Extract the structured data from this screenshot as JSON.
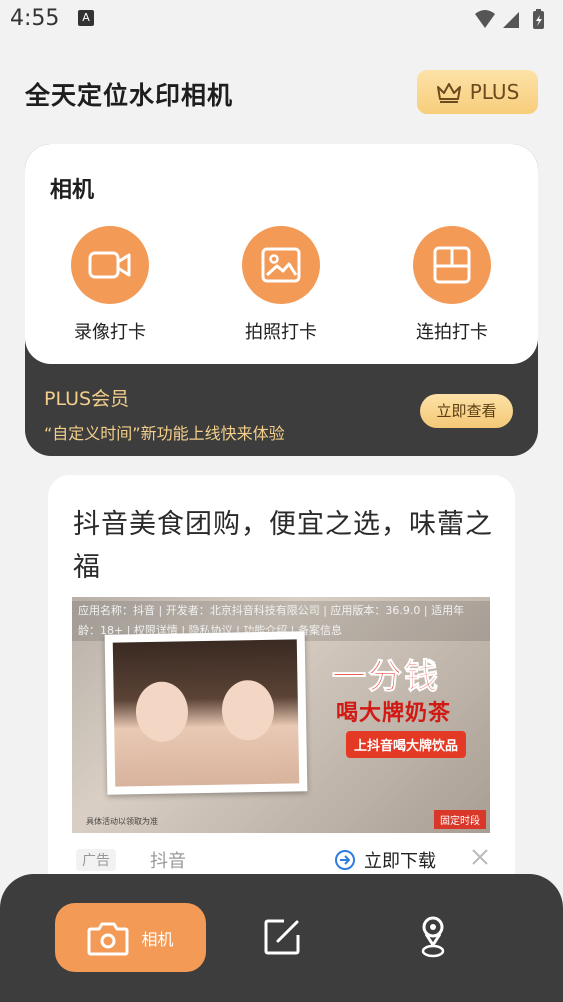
{
  "status_bar": {
    "time": "4:55",
    "notification_badge": "A",
    "icons": [
      "wifi-icon",
      "signal-icon",
      "battery-icon"
    ]
  },
  "header": {
    "title": "全天定位水印相机",
    "plus_label": "PLUS"
  },
  "camera_section": {
    "title": "相机",
    "items": [
      {
        "label": "录像打卡",
        "icon": "video-icon"
      },
      {
        "label": "拍照打卡",
        "icon": "image-icon"
      },
      {
        "label": "连拍打卡",
        "icon": "layout-icon"
      }
    ]
  },
  "plus_member": {
    "title": "PLUS会员",
    "subtitle": "“自定义时间”新功能上线快来体验",
    "button": "立即查看"
  },
  "ad": {
    "title": "抖音美食团购，便宜之选，味蕾之福",
    "info_text": "应用名称：抖音 | 开发者：北京抖音科技有限公司 | 应用版本：36.9.0 | 适用年龄：18+ | 权限详情 | 隐私协议 | 功能介绍 | 备案信息",
    "promo_line1": "一分钱",
    "promo_line2": "喝大牌奶茶",
    "promo_line3": "上抖音喝大牌饮品",
    "corner_tag": "固定时段",
    "fine_print": "具体活动以领取为准",
    "badge": "广告",
    "source": "抖音",
    "download": "立即下载"
  },
  "bottom_nav": {
    "active_label": "相机",
    "items": [
      "camera-icon",
      "edit-icon",
      "location-icon"
    ]
  },
  "colors": {
    "accent": "#f29a56",
    "dark": "#3d3d3d",
    "gold": "#f3cf8b",
    "background": "#f2f2f2"
  }
}
